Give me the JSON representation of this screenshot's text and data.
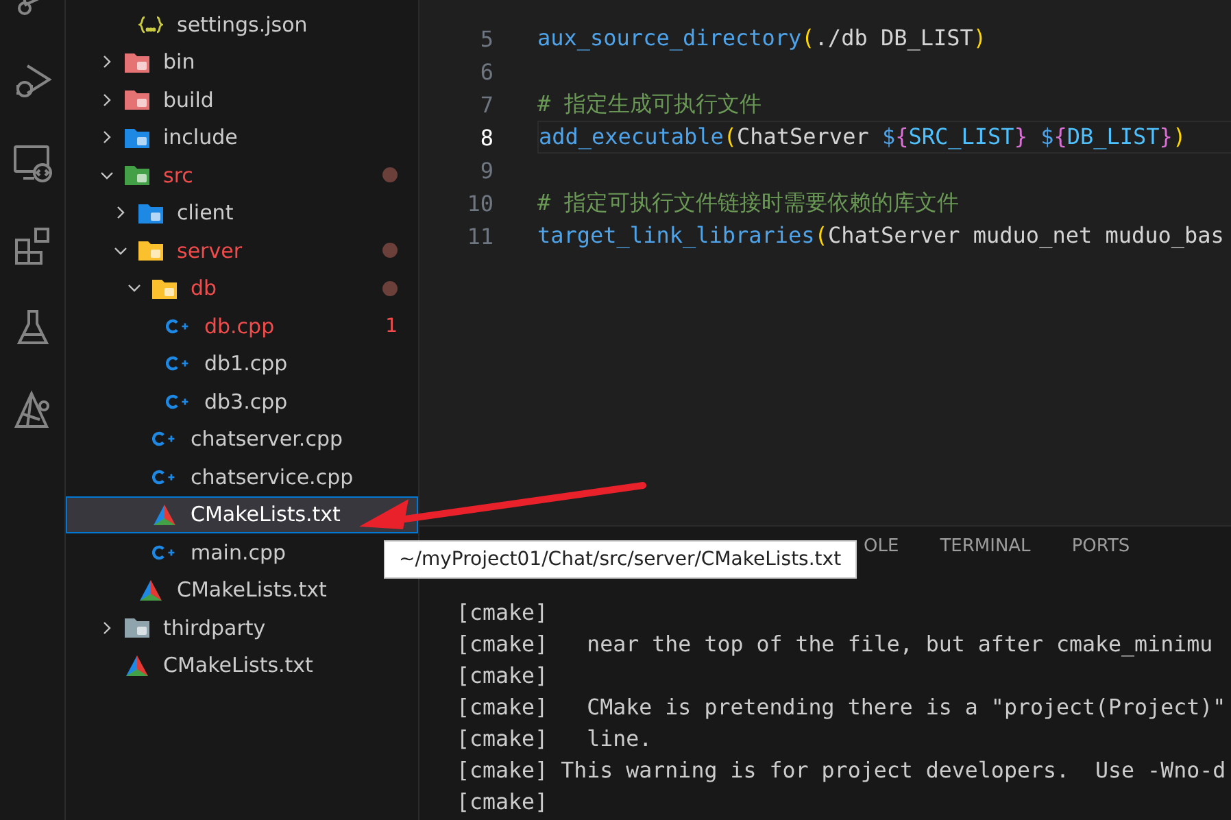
{
  "activity_bar": [
    {
      "kind": "source-control"
    },
    {
      "kind": "run-debug"
    },
    {
      "kind": "remote"
    },
    {
      "kind": "extensions"
    },
    {
      "kind": "testing"
    },
    {
      "kind": "cmake"
    }
  ],
  "explorer": {
    "items": [
      {
        "children": [
          {
            "name": "settings.json",
            "kind": "json",
            "modified": false,
            "error": false,
            "selected": false
          }
        ]
      },
      {
        "name": "bin",
        "kind": "folder-red",
        "expanded": false,
        "modified": false,
        "error": false,
        "selected": false
      },
      {
        "name": "build",
        "kind": "folder-red",
        "expanded": false,
        "modified": false,
        "error": false,
        "selected": false
      },
      {
        "name": "include",
        "kind": "folder-include",
        "expanded": false,
        "modified": false,
        "error": false,
        "selected": false
      },
      {
        "name": "src",
        "kind": "folder-src",
        "expanded": true,
        "modified": true,
        "error": true,
        "selected": false,
        "children": [
          {
            "name": "client",
            "kind": "folder-client",
            "expanded": false,
            "modified": false,
            "error": false,
            "selected": false
          },
          {
            "name": "server",
            "kind": "folder-server",
            "expanded": true,
            "modified": true,
            "error": true,
            "selected": false,
            "children": [
              {
                "name": "db",
                "kind": "folder-db",
                "expanded": true,
                "modified": true,
                "error": true,
                "selected": false,
                "children": [
                  {
                    "name": "db.cpp",
                    "kind": "cpp",
                    "modified": false,
                    "error": true,
                    "selected": false,
                    "badge": "1"
                  },
                  {
                    "name": "db1.cpp",
                    "kind": "cpp",
                    "modified": false,
                    "error": false,
                    "selected": false
                  },
                  {
                    "name": "db3.cpp",
                    "kind": "cpp",
                    "modified": false,
                    "error": false,
                    "selected": false
                  }
                ]
              },
              {
                "name": "chatserver.cpp",
                "kind": "cpp",
                "modified": false,
                "error": false,
                "selected": false
              },
              {
                "name": "chatservice.cpp",
                "kind": "cpp",
                "modified": false,
                "error": false,
                "selected": false
              },
              {
                "name": "CMakeLists.txt",
                "kind": "cmake",
                "modified": false,
                "error": false,
                "selected": true
              },
              {
                "name": "main.cpp",
                "kind": "cpp",
                "modified": false,
                "error": false,
                "selected": false
              }
            ]
          },
          {
            "name": "CMakeLists.txt",
            "kind": "cmake",
            "modified": false,
            "error": false,
            "selected": false
          }
        ]
      },
      {
        "name": "thirdparty",
        "kind": "folder-plain",
        "expanded": false,
        "modified": false,
        "error": false,
        "selected": false
      },
      {
        "name": "CMakeLists.txt",
        "kind": "cmake",
        "modified": false,
        "error": false,
        "selected": false
      }
    ]
  },
  "editor": {
    "lines": [
      {
        "number": "5",
        "current": false,
        "tokens": [
          {
            "text": "aux_source_directory",
            "kind": "function"
          },
          {
            "text": "(",
            "kind": "paren"
          },
          {
            "text": "./db DB_LIST",
            "kind": "plain"
          },
          {
            "text": ")",
            "kind": "paren"
          }
        ]
      },
      {
        "number": "6",
        "current": false
      },
      {
        "number": "7",
        "current": false,
        "tokens": [
          {
            "text": "# 指定生成可执行文件",
            "kind": "comment"
          }
        ]
      },
      {
        "number": "8",
        "current": true,
        "tokens": [
          {
            "text": "add_executable",
            "kind": "function"
          },
          {
            "text": "(",
            "kind": "paren"
          },
          {
            "text": "ChatServer ",
            "kind": "plain"
          },
          {
            "text": "$",
            "kind": "dollar"
          },
          {
            "text": "{",
            "kind": "brace"
          },
          {
            "text": "SRC_LIST",
            "kind": "variable"
          },
          {
            "text": "}",
            "kind": "brace"
          },
          {
            "text": " $",
            "kind": "dollar"
          },
          {
            "text": "{",
            "kind": "brace"
          },
          {
            "text": "DB_LIST",
            "kind": "variable"
          },
          {
            "text": "}",
            "kind": "brace"
          },
          {
            "text": ")",
            "kind": "paren"
          }
        ]
      },
      {
        "number": "9",
        "current": false
      },
      {
        "number": "10",
        "current": false,
        "tokens": [
          {
            "text": "# 指定可执行文件链接时需要依赖的库文件",
            "kind": "comment"
          }
        ]
      },
      {
        "number": "11",
        "current": false,
        "tokens": [
          {
            "text": "target_link_libraries",
            "kind": "function"
          },
          {
            "text": "(",
            "kind": "paren"
          },
          {
            "text": "ChatServer muduo_net muduo_bas",
            "kind": "plain"
          }
        ]
      }
    ]
  },
  "panel": {
    "tabs": [
      {
        "label": "OLE",
        "selected": false
      },
      {
        "label": "TERMINAL",
        "selected": false
      },
      {
        "label": "PORTS",
        "selected": false
      }
    ],
    "output": [
      "[cmake]",
      "[cmake]   near the top of the file, but after cmake_minimu",
      "[cmake]",
      "[cmake]   CMake is pretending there is a \"project(Project)\"",
      "[cmake]   line.",
      "[cmake] This warning is for project developers.  Use -Wno-d",
      "[cmake]"
    ]
  },
  "tooltip": {
    "text": "~/myProject01/Chat/src/server/CMakeLists.txt"
  }
}
